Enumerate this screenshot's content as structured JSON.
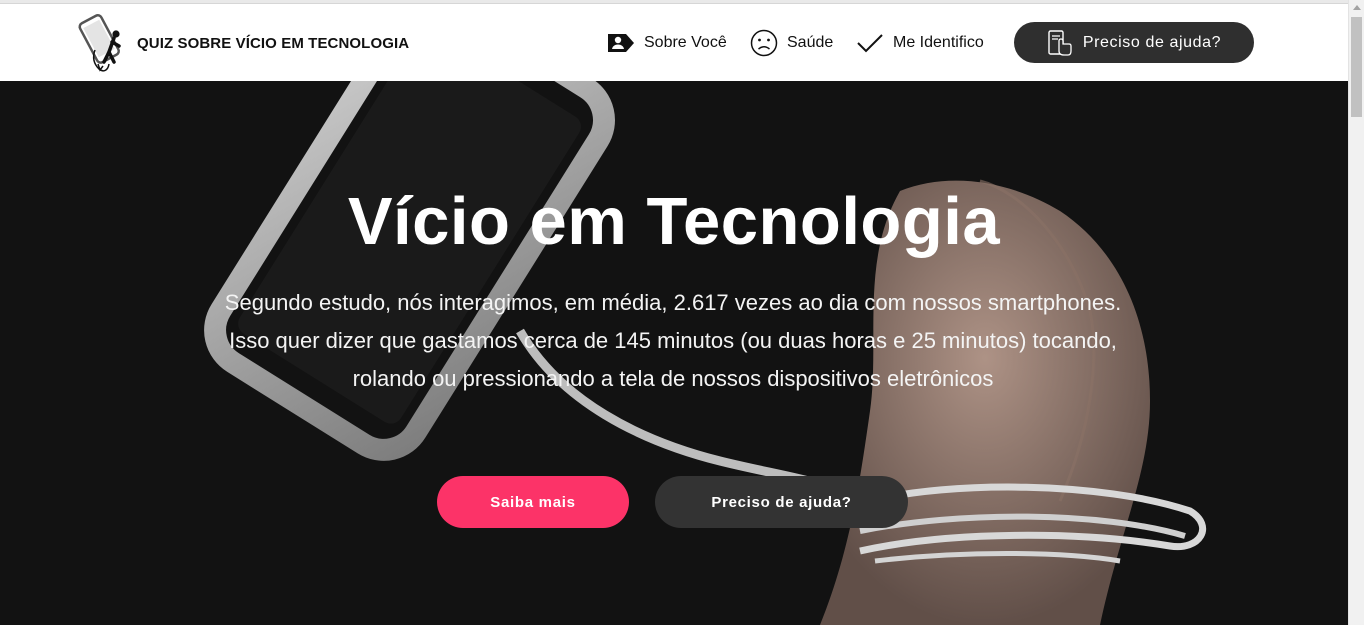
{
  "header": {
    "site_title": "QUIZ SOBRE VÍCIO EM TECNOLOGIA",
    "nav": [
      {
        "label": "Sobre Você",
        "icon": "id-card-icon"
      },
      {
        "label": "Saúde",
        "icon": "sad-face-icon"
      },
      {
        "label": "Me Identifico",
        "icon": "checkmark-icon"
      }
    ],
    "help_button": {
      "label": "Preciso de ajuda?",
      "icon": "touch-phone-icon"
    }
  },
  "hero": {
    "title": "Vício em Tecnologia",
    "description": "Segundo estudo, nós interagimos, em média, 2.617 vezes ao dia com nossos smartphones. Isso quer dizer que gastamos cerca de 145 minutos (ou duas horas e 25 minutos) tocando, rolando ou pressionando a tela de nossos dispositivos eletrônicos",
    "buttons": {
      "primary": "Saiba mais",
      "secondary": "Preciso de ajuda?"
    }
  },
  "colors": {
    "accent": "#fc3368",
    "dark_button": "#2f2f2f",
    "hero_background": "#121212"
  }
}
